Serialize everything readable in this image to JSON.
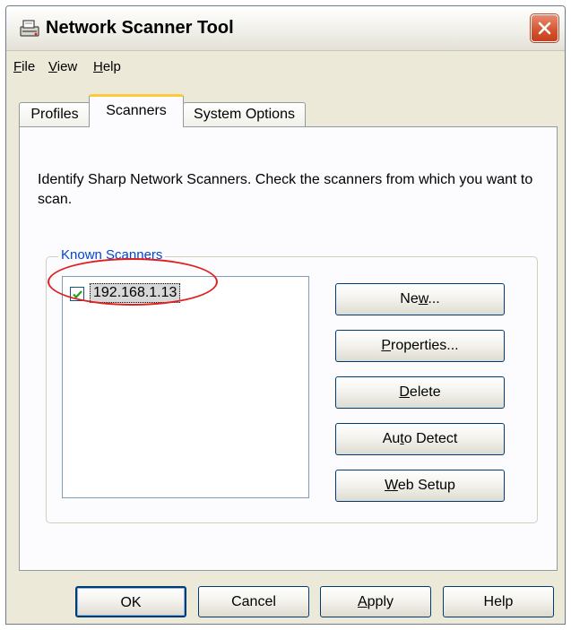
{
  "window": {
    "title": "Network Scanner Tool",
    "icons": {
      "app": "scanner-app-icon",
      "close": "close-icon"
    }
  },
  "menu": [
    {
      "mnemonic": "F",
      "rest": "ile"
    },
    {
      "mnemonic": "V",
      "rest": "iew"
    },
    {
      "mnemonic": "H",
      "rest": "elp"
    }
  ],
  "tabs": [
    {
      "label": "Profiles",
      "active": false
    },
    {
      "label": "Scanners",
      "active": true
    },
    {
      "label": "System Options",
      "active": false
    }
  ],
  "panel": {
    "description": "Identify Sharp Network Scanners. Check the scanners from which you want to scan."
  },
  "known_scanners": {
    "legend": "Known Scanners",
    "items": [
      {
        "label": "192.168.1.13",
        "checked": true,
        "selected": true,
        "circled": true
      }
    ],
    "buttons": [
      {
        "pre": "Ne",
        "mnemonic": "w",
        "post": "..."
      },
      {
        "pre": "",
        "mnemonic": "P",
        "post": "roperties..."
      },
      {
        "pre": "",
        "mnemonic": "D",
        "post": "elete"
      },
      {
        "pre": "Au",
        "mnemonic": "t",
        "post": "o Detect"
      },
      {
        "pre": "",
        "mnemonic": "W",
        "post": "eb Setup"
      }
    ]
  },
  "dialog_buttons": {
    "ok": "OK",
    "cancel": "Cancel",
    "apply": {
      "pre": "",
      "mnemonic": "A",
      "post": "pply"
    },
    "help": "Help"
  },
  "colors": {
    "title_bar": "#f1f0ea",
    "window_bg": "#ece9d8",
    "panel_bg": "#fcfcfe",
    "close_button": "#d4532e",
    "active_tab_accent": "#ffc73c",
    "group_legend": "#0046d5",
    "annotation_circle": "#e02020"
  }
}
